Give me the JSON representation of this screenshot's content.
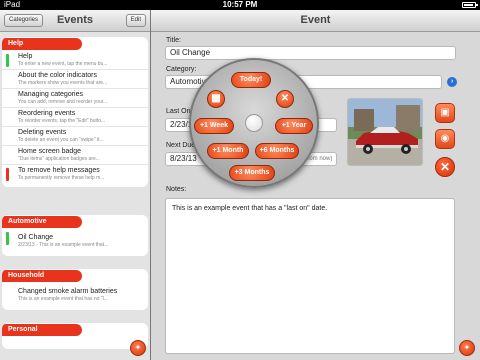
{
  "status": {
    "carrier": "iPad",
    "time": "10:57 PM"
  },
  "left": {
    "title": "Events",
    "categories_label": "Categories",
    "edit_label": "Edit",
    "sections": [
      {
        "name": "Help",
        "rows": [
          {
            "title": "Help",
            "subtitle": "To enter a new event, tap the menu bu...",
            "flag": "green"
          },
          {
            "title": "About the color indicators",
            "subtitle": "The markers show you events that are...",
            "flag": ""
          },
          {
            "title": "Managing categories",
            "subtitle": "You can add, remove and reorder your...",
            "flag": ""
          },
          {
            "title": "Reordering events",
            "subtitle": "To reorder events, tap the \"Edit\" butto...",
            "flag": ""
          },
          {
            "title": "Deleting events",
            "subtitle": "To delete an event you can \"swipe\" it...",
            "flag": ""
          },
          {
            "title": "Home screen badge",
            "subtitle": "\"Due items\" application badges are...",
            "flag": ""
          },
          {
            "title": "To remove help messages",
            "subtitle": "To permanently remove these help m...",
            "flag": "red"
          }
        ]
      },
      {
        "name": "Automotive",
        "rows": [
          {
            "title": "Oil Change",
            "subtitle": "2/23/13 - This is an example event that...",
            "flag": "green"
          }
        ]
      },
      {
        "name": "Household",
        "rows": [
          {
            "title": "Changed smoke alarm batteries",
            "subtitle": "This is an example event that has no \"l...",
            "flag": ""
          }
        ]
      },
      {
        "name": "Personal",
        "rows": []
      }
    ]
  },
  "right": {
    "title": "Event",
    "title_label": "Title:",
    "title_value": "Oil Change",
    "category_label": "Category:",
    "category_value": "Automotive",
    "last_label": "Last On:",
    "last_value": "2/23/13",
    "next_label": "Next Due:",
    "next_value": "8/23/13",
    "next_hint": "(in 2 days from now)",
    "notes_label": "Notes:",
    "notes_value": "This is an example event that has a \"last on\" date."
  },
  "wheel": {
    "today": "Today!",
    "plus_1_week": "+1 Week",
    "plus_1_year": "+1 Year",
    "plus_1_month": "+1 Month",
    "plus_6_months": "+6 Months",
    "plus_3_months": "+3 Months"
  },
  "icons": {
    "calendar": "calendar-icon",
    "close": "close-icon",
    "image": "image-icon",
    "camera": "camera-icon",
    "delete": "delete-icon",
    "info": "info-icon",
    "menu": "menu-icon"
  },
  "colors": {
    "accent": "#e8341d",
    "flag_green": "#2ec94a",
    "info_blue": "#2a6fd6"
  }
}
